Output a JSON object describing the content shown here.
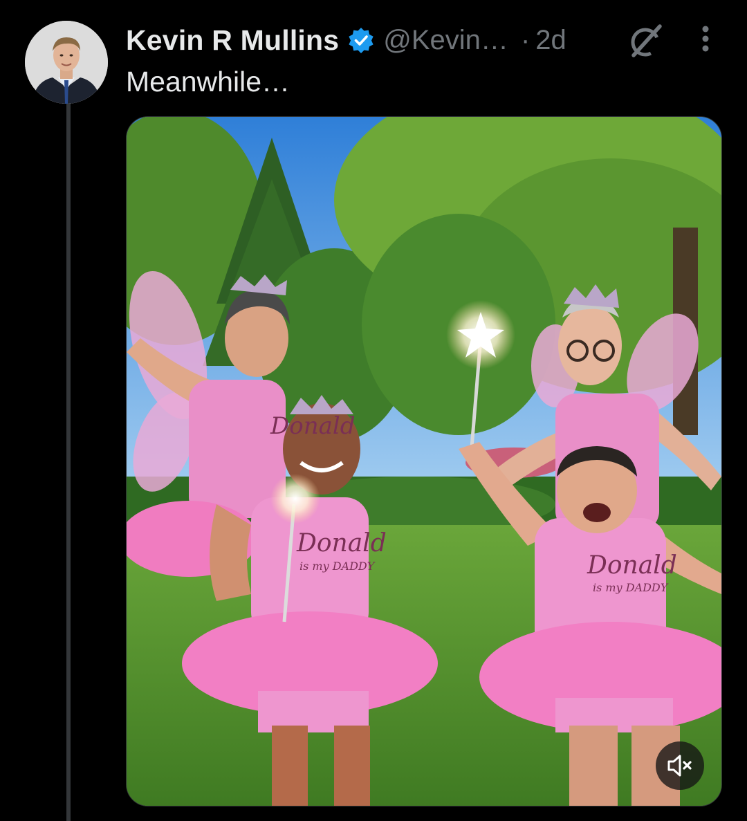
{
  "tweet": {
    "author": {
      "display_name": "Kevin R Mullins",
      "handle": "@Kevin…",
      "verified": true
    },
    "separator": "·",
    "timestamp": "2d",
    "text": "Meanwhile…",
    "media": {
      "type": "video",
      "muted": true,
      "shirt_text": [
        "Donald",
        "is my DADDY"
      ]
    }
  },
  "icons": {
    "verified": "verified-badge-icon",
    "grok": "grok-icon",
    "more": "more-options-icon",
    "mute": "speaker-muted-icon"
  },
  "colors": {
    "background": "#000000",
    "text_primary": "#e7e9ea",
    "text_secondary": "#71767b",
    "verified_blue": "#1d9bf0",
    "thread_line": "#333639"
  }
}
